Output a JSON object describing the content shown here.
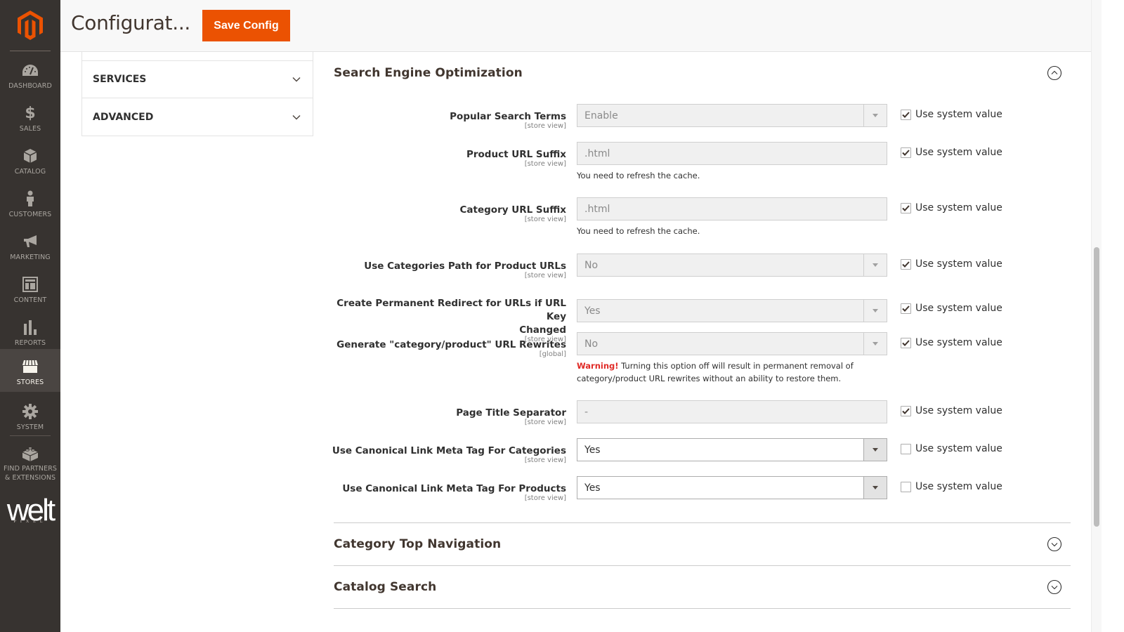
{
  "nav": {
    "logo": "magento-logo",
    "items": [
      {
        "label": "DASHBOARD",
        "icon": "dashboard-gauge-icon",
        "active": false
      },
      {
        "label": "SALES",
        "icon": "dollar-icon",
        "active": false
      },
      {
        "label": "CATALOG",
        "icon": "box-icon",
        "active": false
      },
      {
        "label": "CUSTOMERS",
        "icon": "person-icon",
        "active": false
      },
      {
        "label": "MARKETING",
        "icon": "megaphone-icon",
        "active": false
      },
      {
        "label": "CONTENT",
        "icon": "layout-icon",
        "active": false
      },
      {
        "label": "REPORTS",
        "icon": "bar-chart-icon",
        "active": false
      },
      {
        "label": "STORES",
        "icon": "storefront-icon",
        "active": true
      },
      {
        "label": "SYSTEM",
        "icon": "gear-icon",
        "active": false
      },
      {
        "label": "FIND PARTNERS & EXTENSIONS",
        "icon": "lego-brick-icon",
        "active": false
      }
    ],
    "brand_logo_text": "welt",
    "brand_logo_subtext": "PIXEL"
  },
  "header": {
    "title": "Configurat...",
    "save_label": "Save Config"
  },
  "config_tabs": [
    {
      "label": "SERVICES"
    },
    {
      "label": "ADVANCED"
    }
  ],
  "sections": {
    "seo": {
      "title": "Search Engine Optimization",
      "expanded": true,
      "fields": [
        {
          "label": "Popular Search Terms",
          "scope": "[store view]",
          "type": "select",
          "value": "Enable",
          "disabled": true,
          "use_system_value": true,
          "system_label": "Use system value"
        },
        {
          "label": "Product URL Suffix",
          "scope": "[store view]",
          "type": "text",
          "value": ".html",
          "disabled": true,
          "note": "You need to refresh the cache.",
          "use_system_value": true,
          "system_label": "Use system value"
        },
        {
          "label": "Category URL Suffix",
          "scope": "[store view]",
          "type": "text",
          "value": ".html",
          "disabled": true,
          "note": "You need to refresh the cache.",
          "use_system_value": true,
          "system_label": "Use system value"
        },
        {
          "label": "Use Categories Path for Product URLs",
          "scope": "[store view]",
          "type": "select",
          "value": "No",
          "disabled": true,
          "use_system_value": true,
          "system_label": "Use system value"
        },
        {
          "label": "Create Permanent Redirect for URLs if URL Key",
          "label_line2": "Changed",
          "scope": "[store view]",
          "type": "select",
          "value": "Yes",
          "disabled": true,
          "use_system_value": true,
          "system_label": "Use system value"
        },
        {
          "label": "Generate \"category/product\" URL Rewrites",
          "scope": "[global]",
          "type": "select",
          "value": "No",
          "disabled": true,
          "warning_label": "Warning!",
          "note": " Turning this option off will result in permanent removal of category/product URL rewrites without an ability to restore them.",
          "use_system_value": true,
          "system_label": "Use system value"
        },
        {
          "label": "Page Title Separator",
          "scope": "[store view]",
          "type": "text",
          "value": "-",
          "disabled": true,
          "use_system_value": true,
          "system_label": "Use system value"
        },
        {
          "label": "Use Canonical Link Meta Tag For Categories",
          "scope": "[store view]",
          "type": "select",
          "value": "Yes",
          "disabled": false,
          "use_system_value": false,
          "system_label": "Use system value"
        },
        {
          "label": "Use Canonical Link Meta Tag For Products",
          "scope": "[store view]",
          "type": "select",
          "value": "Yes",
          "disabled": false,
          "use_system_value": false,
          "system_label": "Use system value"
        }
      ]
    },
    "category_top_nav": {
      "title": "Category Top Navigation",
      "expanded": false
    },
    "catalog_search": {
      "title": "Catalog Search",
      "expanded": false
    }
  },
  "colors": {
    "accent": "#eb5202",
    "nav_bg": "#373330",
    "warning": "#e02b27"
  }
}
